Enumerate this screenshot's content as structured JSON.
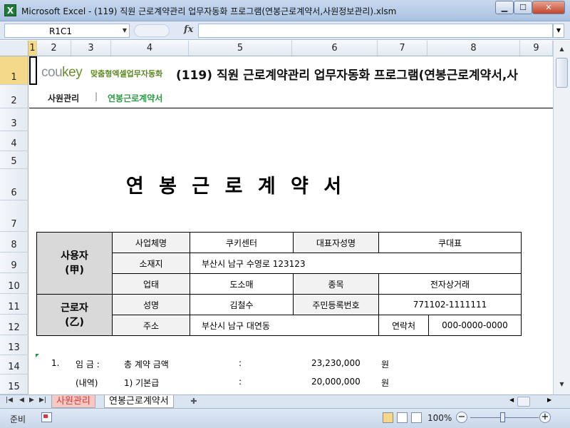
{
  "window": {
    "app_icon": "X",
    "title": "Microsoft Excel - (119) 직원 근로계약관리 업무자동화 프로그램(연봉근로계약서,사원정보관리).xlsm",
    "minimize_icon": "minimize-icon",
    "maximize_icon": "maximize-icon",
    "close_icon": "close-icon"
  },
  "formula_bar": {
    "name_box": "R1C1",
    "fx_label": "fx",
    "formula": ""
  },
  "columns": [
    "1",
    "2",
    "3",
    "4",
    "5",
    "6",
    "7",
    "8",
    "9"
  ],
  "rows": [
    "1",
    "2",
    "3",
    "4",
    "5",
    "6",
    "7",
    "8",
    "9",
    "10",
    "11",
    "12",
    "13",
    "14",
    "15"
  ],
  "header": {
    "logo_main": "cou",
    "logo_key": "key",
    "logo_sub": "맞춤형엑셀업무자동화",
    "title": "(119) 직원 근로계약관리 업무자동화 프로그램(연봉근로계약서,사"
  },
  "nav": {
    "link1": "사원관리",
    "separator": "|",
    "link2": "연봉근로계약서"
  },
  "document": {
    "title": "연 봉 근 로 계 약 서"
  },
  "info_table": {
    "employer_label": "사용자",
    "employer_sub": "(甲)",
    "business_name_label": "사업체명",
    "business_name": "쿠키센터",
    "rep_label": "대표자성명",
    "rep_name": "쿠대표",
    "address_label": "소재지",
    "address": "부산시 남구 수영로 123123",
    "business_type_label": "업태",
    "business_type": "도소매",
    "category_label": "종목",
    "category": "전자상거래",
    "worker_label": "근로자",
    "worker_sub": "(乙)",
    "name_label": "성명",
    "name": "김철수",
    "id_label": "주민등록번호",
    "id_number": "771102-1111111",
    "worker_address_label": "주소",
    "worker_address": "부산시 남구 대연동",
    "contact_label": "연락처",
    "contact": "000-0000-0000"
  },
  "contract": {
    "item1_no": "1.",
    "item1_label": "임 금 :",
    "item1_desc": "총 계약 금액",
    "item1_colon": ":",
    "item1_amount": "23,230,000",
    "item1_unit": "원",
    "item2_label": "(내역)",
    "item2_desc": "1) 기본급",
    "item2_colon": ":",
    "item2_amount": "20,000,000",
    "item2_unit": "원"
  },
  "sheet_tabs": {
    "tab1": "사원관리",
    "tab2": "연봉근로계약서"
  },
  "status": {
    "ready": "준비",
    "zoom": "100%",
    "zoom_percent": 100
  }
}
